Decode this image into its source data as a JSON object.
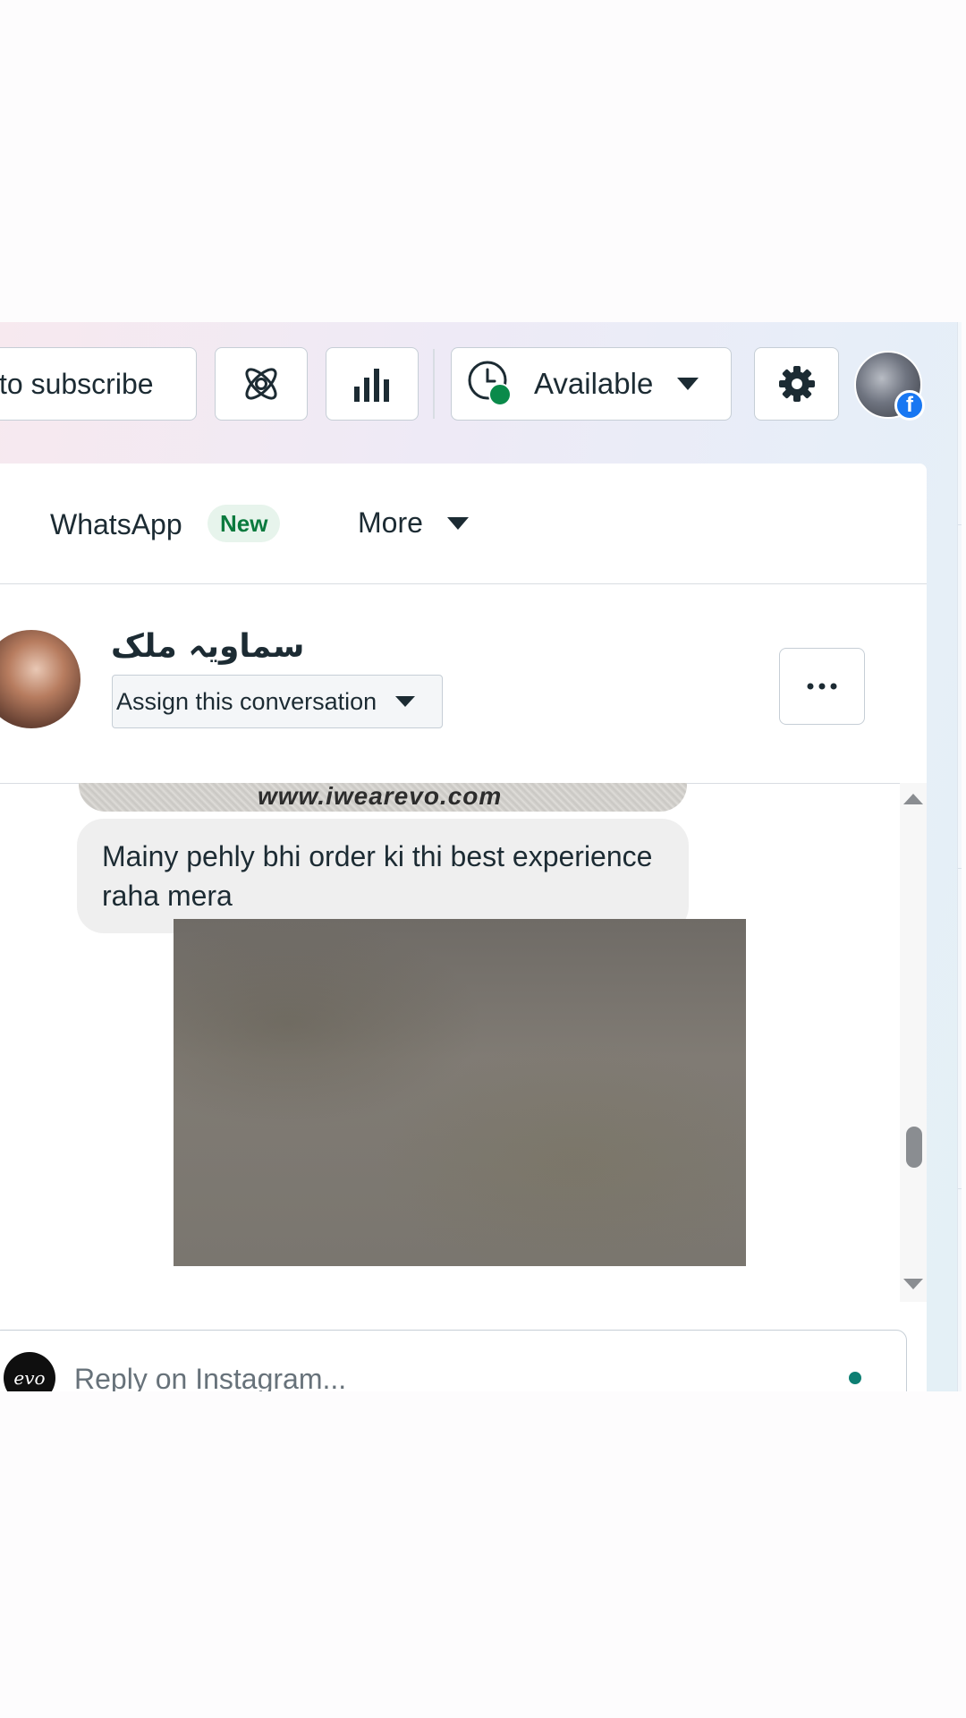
{
  "toolbar": {
    "subscribe_label": "to subscribe",
    "status_label": "Available"
  },
  "tabs": {
    "whatsapp_label": "WhatsApp",
    "new_badge": "New",
    "more_label": "More"
  },
  "conversation": {
    "contact_name": "سماویہ ملک",
    "assign_label": "Assign this conversation",
    "image_watermark": "www.iwearevo.com",
    "message_text": "Mainy pehly bhi order ki thi best experience raha mera"
  },
  "reply": {
    "placeholder": "Reply on Instagram...",
    "page_avatar_text": "evo"
  },
  "colors": {
    "status_online": "#0a8a4a",
    "facebook_blue": "#1877f2",
    "new_badge_text": "#0a7a3e",
    "reply_dot": "#0d7f73"
  },
  "icons": {
    "ai": "atom-icon",
    "insights": "bar-chart-icon",
    "status": "clock-icon",
    "settings": "gear-icon",
    "options": "more-dots-icon",
    "dropdown": "caret-down-icon"
  }
}
